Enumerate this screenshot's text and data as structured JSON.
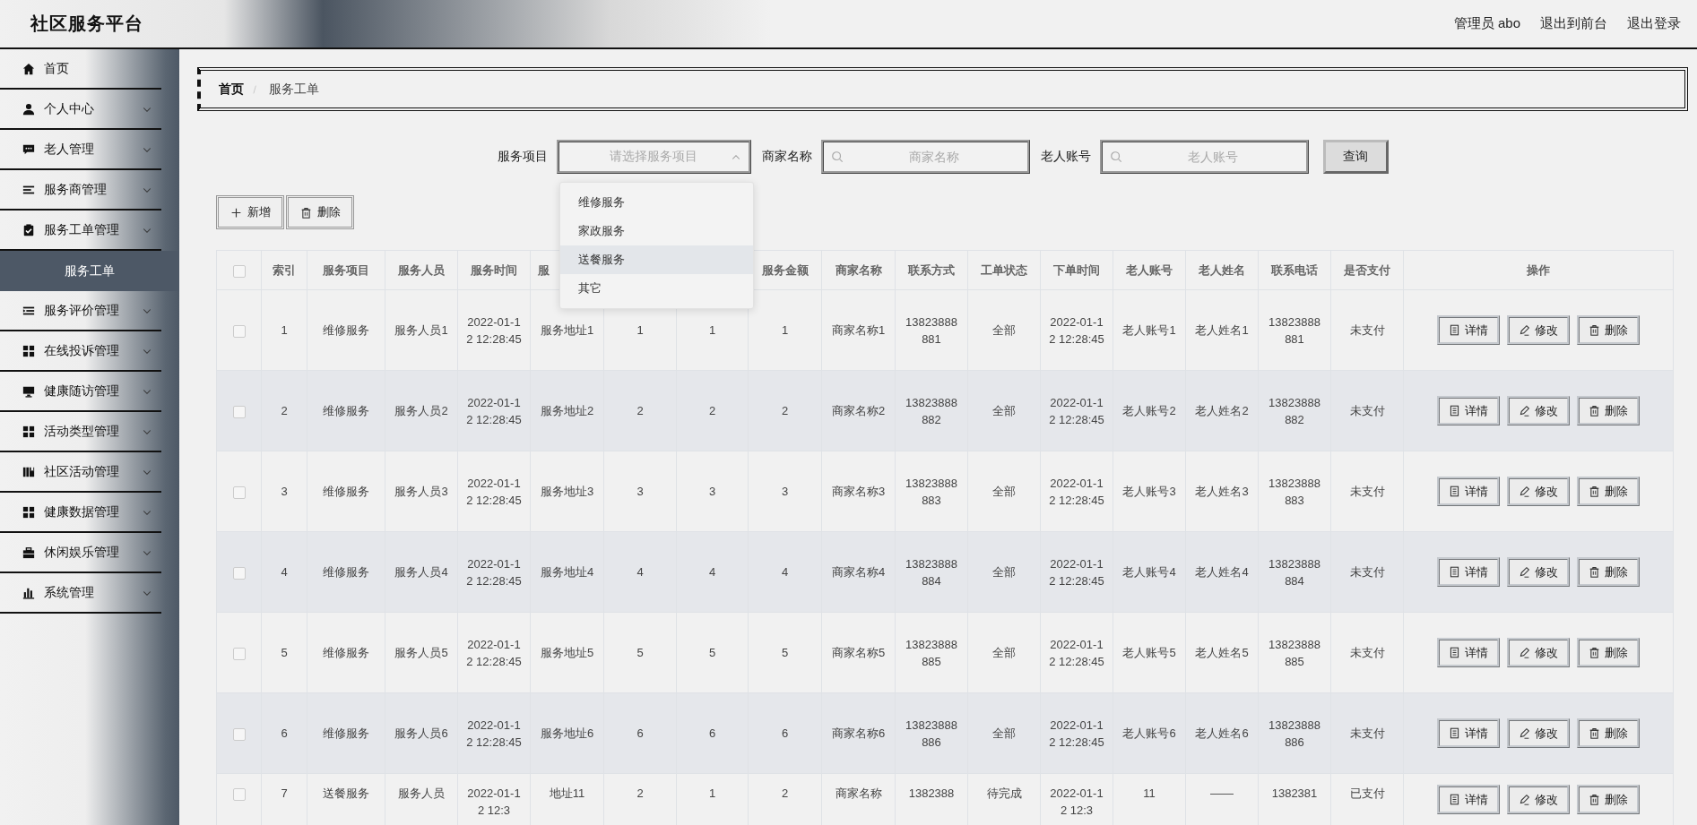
{
  "header": {
    "title": "社区服务平台",
    "links": [
      "管理员 abo",
      "退出到前台",
      "退出登录"
    ]
  },
  "sidebar": {
    "items": [
      {
        "label": "首页",
        "kind": "link"
      },
      {
        "label": "个人中心",
        "kind": "submenu"
      },
      {
        "label": "老人管理",
        "kind": "submenu"
      },
      {
        "label": "服务商管理",
        "kind": "submenu"
      },
      {
        "label": "服务工单管理",
        "kind": "submenu",
        "children": [
          {
            "label": "服务工单",
            "selected": true
          }
        ]
      },
      {
        "label": "服务评价管理",
        "kind": "submenu"
      },
      {
        "label": "在线投诉管理",
        "kind": "submenu"
      },
      {
        "label": "健康随访管理",
        "kind": "submenu"
      },
      {
        "label": "活动类型管理",
        "kind": "submenu"
      },
      {
        "label": "社区活动管理",
        "kind": "submenu"
      },
      {
        "label": "健康数据管理",
        "kind": "submenu"
      },
      {
        "label": "休闲娱乐管理",
        "kind": "submenu"
      },
      {
        "label": "系统管理",
        "kind": "submenu"
      }
    ]
  },
  "breadcrumb": [
    "首页",
    "服务工单"
  ],
  "filters": {
    "service_select": {
      "label": "服务项目",
      "placeholder": "请选择服务项目",
      "expanded": true,
      "options": [
        {
          "label": "维修服务",
          "hovered": false
        },
        {
          "label": "家政服务",
          "hovered": false
        },
        {
          "label": "送餐服务",
          "hovered": true
        },
        {
          "label": "其它",
          "hovered": false
        }
      ]
    },
    "fields": [
      {
        "label": "商家名称",
        "placeholder": "商家名称"
      },
      {
        "label": "老人账号",
        "placeholder": "老人账号"
      }
    ],
    "search_button": "查询"
  },
  "toolbar": [
    {
      "kind": "add",
      "label": "新增"
    },
    {
      "kind": "delete",
      "label": "删除"
    }
  ],
  "table": {
    "header_checked": false,
    "columns": [
      {
        "label": "索引"
      },
      {
        "label": "服务项目"
      },
      {
        "label": "服务人员"
      },
      {
        "label": "服务时间"
      },
      {
        "label": "服"
      },
      {},
      {},
      {
        "label": "服务金额"
      },
      {
        "label": "商家名称"
      },
      {
        "label": "联系方式"
      },
      {
        "label": "工单状态"
      },
      {
        "label": "下单时间"
      },
      {
        "label": "老人账号"
      },
      {
        "label": "老人姓名"
      },
      {
        "label": "联系电话"
      },
      {
        "label": "是否支付"
      },
      {
        "label": "操作"
      }
    ],
    "rows": [
      {
        "checked": false,
        "cells": [
          "1",
          "维修服务",
          "服务人员1",
          "2022-01-12 12:28:45",
          "服务地址1",
          "1",
          "1",
          "1",
          "商家名称1",
          "13823888881",
          "全部",
          "2022-01-12 12:28:45",
          "老人账号1",
          "老人姓名1",
          "13823888881",
          "未支付"
        ],
        "actions": [
          "详情",
          "修改",
          "删除"
        ]
      },
      {
        "checked": false,
        "cells": [
          "2",
          "维修服务",
          "服务人员2",
          "2022-01-12 12:28:45",
          "服务地址2",
          "2",
          "2",
          "2",
          "商家名称2",
          "13823888882",
          "全部",
          "2022-01-12 12:28:45",
          "老人账号2",
          "老人姓名2",
          "13823888882",
          "未支付"
        ],
        "actions": [
          "详情",
          "修改",
          "删除"
        ]
      },
      {
        "checked": false,
        "cells": [
          "3",
          "维修服务",
          "服务人员3",
          "2022-01-12 12:28:45",
          "服务地址3",
          "3",
          "3",
          "3",
          "商家名称3",
          "13823888883",
          "全部",
          "2022-01-12 12:28:45",
          "老人账号3",
          "老人姓名3",
          "13823888883",
          "未支付"
        ],
        "actions": [
          "详情",
          "修改",
          "删除"
        ]
      },
      {
        "checked": false,
        "cells": [
          "4",
          "维修服务",
          "服务人员4",
          "2022-01-12 12:28:45",
          "服务地址4",
          "4",
          "4",
          "4",
          "商家名称4",
          "13823888884",
          "全部",
          "2022-01-12 12:28:45",
          "老人账号4",
          "老人姓名4",
          "13823888884",
          "未支付"
        ],
        "actions": [
          "详情",
          "修改",
          "删除"
        ]
      },
      {
        "checked": false,
        "cells": [
          "5",
          "维修服务",
          "服务人员5",
          "2022-01-12 12:28:45",
          "服务地址5",
          "5",
          "5",
          "5",
          "商家名称5",
          "13823888885",
          "全部",
          "2022-01-12 12:28:45",
          "老人账号5",
          "老人姓名5",
          "13823888885",
          "未支付"
        ],
        "actions": [
          "详情",
          "修改",
          "删除"
        ]
      },
      {
        "checked": false,
        "cells": [
          "6",
          "维修服务",
          "服务人员6",
          "2022-01-12 12:28:45",
          "服务地址6",
          "6",
          "6",
          "6",
          "商家名称6",
          "13823888886",
          "全部",
          "2022-01-12 12:28:45",
          "老人账号6",
          "老人姓名6",
          "13823888886",
          "未支付"
        ],
        "actions": [
          "详情",
          "修改",
          "删除"
        ]
      },
      {
        "checked": false,
        "cells": [
          "7",
          "送餐服务",
          "服务人员",
          "2022-01-12 12:3",
          "地址11",
          "2",
          "1",
          "2",
          "商家名称",
          "1382388",
          "待完成",
          "2022-01-12 12:3",
          "11",
          "——",
          "1382381",
          "已支付"
        ],
        "actions": [
          "详情",
          "修改",
          "删除"
        ]
      }
    ]
  }
}
